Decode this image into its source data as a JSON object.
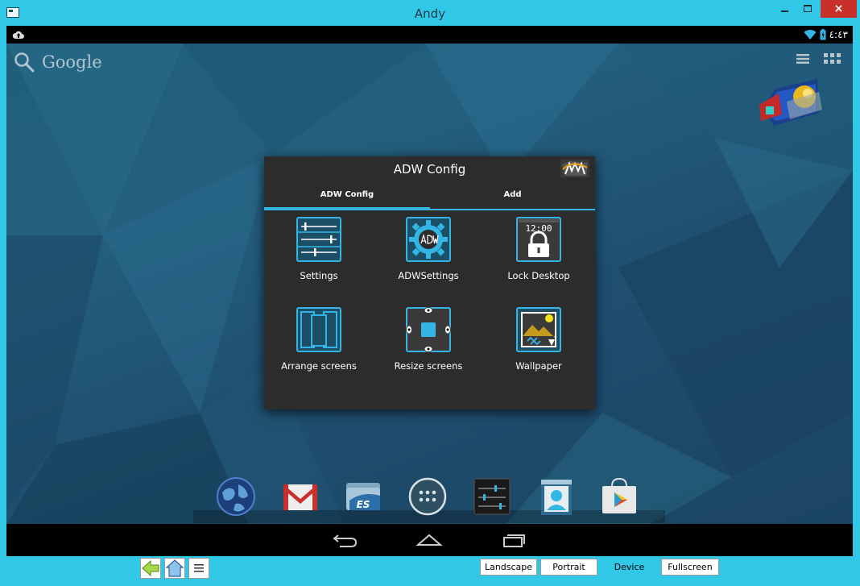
{
  "window": {
    "title": "Andy",
    "close_label": "×"
  },
  "statusbar": {
    "clock": "٤:٤٣"
  },
  "search": {
    "label": "Google"
  },
  "dialog": {
    "title": "ADW Config",
    "tabs": [
      {
        "label": "ADW Config",
        "active": true
      },
      {
        "label": "Add",
        "active": false
      }
    ],
    "items": [
      {
        "label": "Settings",
        "icon": "sliders-icon"
      },
      {
        "label": "ADWSettings",
        "icon": "adw-gear-icon"
      },
      {
        "label": "Lock Desktop",
        "icon": "lock-icon",
        "clock_text": "12:00"
      },
      {
        "label": "Arrange screens",
        "icon": "arrange-screens-icon"
      },
      {
        "label": "Resize screens",
        "icon": "resize-screens-icon"
      },
      {
        "label": "Wallpaper",
        "icon": "wallpaper-icon"
      }
    ]
  },
  "dock": {
    "items": [
      {
        "name": "browser-globe-icon"
      },
      {
        "name": "gmail-icon"
      },
      {
        "name": "es-file-explorer-icon"
      },
      {
        "name": "app-drawer-icon"
      },
      {
        "name": "settings-app-icon"
      },
      {
        "name": "contacts-icon"
      },
      {
        "name": "play-store-icon"
      }
    ]
  },
  "bottom_bar": {
    "landscape": "Landscape",
    "portrait": "Portrait",
    "device": "Device",
    "fullscreen": "Fullscreen"
  },
  "colors": {
    "accent": "#33b5e5",
    "window_frame": "#31c8e8",
    "close_red": "#c7312a"
  }
}
